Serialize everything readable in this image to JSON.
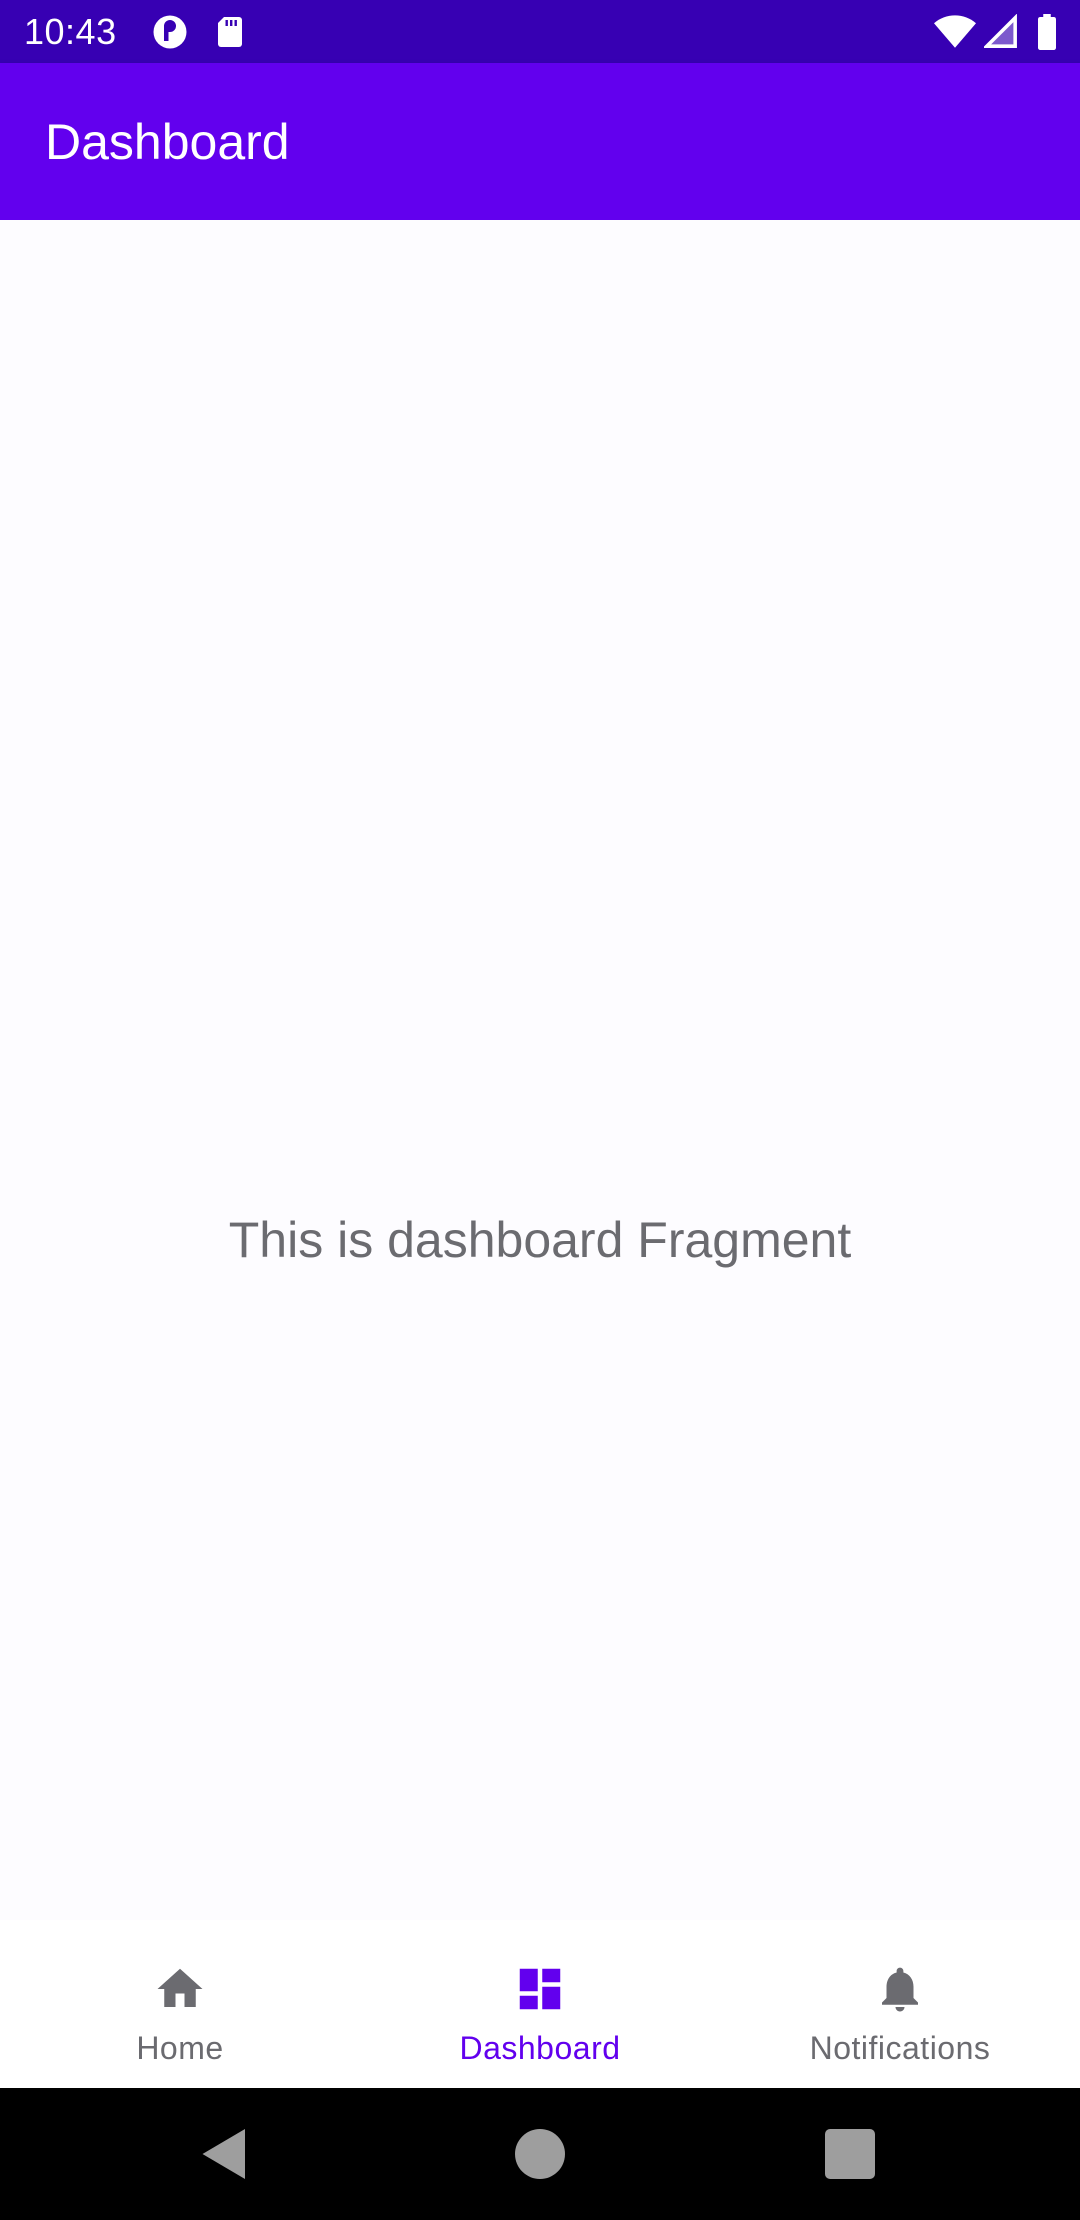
{
  "status_bar": {
    "time": "10:43",
    "left_icons": [
      "pocket-casts-icon",
      "sd-card-icon"
    ],
    "right_icons": [
      "wifi-icon",
      "cellular-signal-icon",
      "battery-icon"
    ]
  },
  "app_bar": {
    "title": "Dashboard"
  },
  "content": {
    "message": "This is dashboard Fragment"
  },
  "bottom_nav": {
    "items": [
      {
        "label": "Home",
        "icon": "home-icon",
        "active": false
      },
      {
        "label": "Dashboard",
        "icon": "dashboard-icon",
        "active": true
      },
      {
        "label": "Notifications",
        "icon": "bell-icon",
        "active": false
      }
    ]
  },
  "system_nav": {
    "buttons": [
      "back-icon",
      "home-circle-icon",
      "recents-icon"
    ]
  },
  "colors": {
    "status_bar": "#3700b3",
    "app_bar": "#6200ee",
    "active": "#6200ee",
    "inactive": "#6b6b70"
  }
}
